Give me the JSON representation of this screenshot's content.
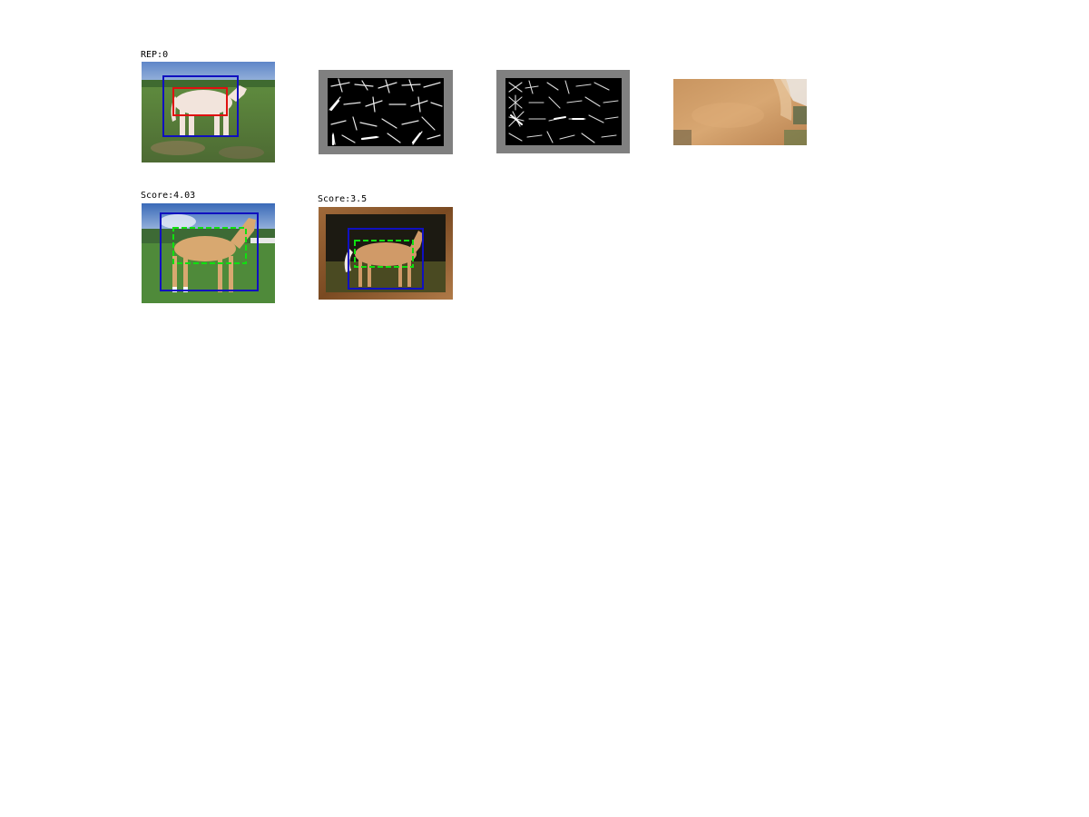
{
  "figure": {
    "row1": {
      "label": "REP:0",
      "panels": [
        {
          "name": "rep-photo",
          "kind": "photo",
          "description": "horse-on-grass"
        },
        {
          "name": "hog-positive",
          "kind": "hog-visualization"
        },
        {
          "name": "hog-negative",
          "kind": "hog-visualization"
        },
        {
          "name": "crop-patch",
          "kind": "photo-crop"
        }
      ]
    },
    "row2": {
      "items": [
        {
          "label": "Score:4.03",
          "kind": "detection-photo"
        },
        {
          "label": "Score:3.5",
          "kind": "detection-photo-framed"
        }
      ]
    }
  },
  "colors": {
    "rep_outer_box": "#1010c0",
    "rep_inner_box": "#e01010",
    "detection_box": "#1010c0",
    "part_box": "#10e010",
    "hog_border": "#808080",
    "hog_background": "#000000"
  }
}
